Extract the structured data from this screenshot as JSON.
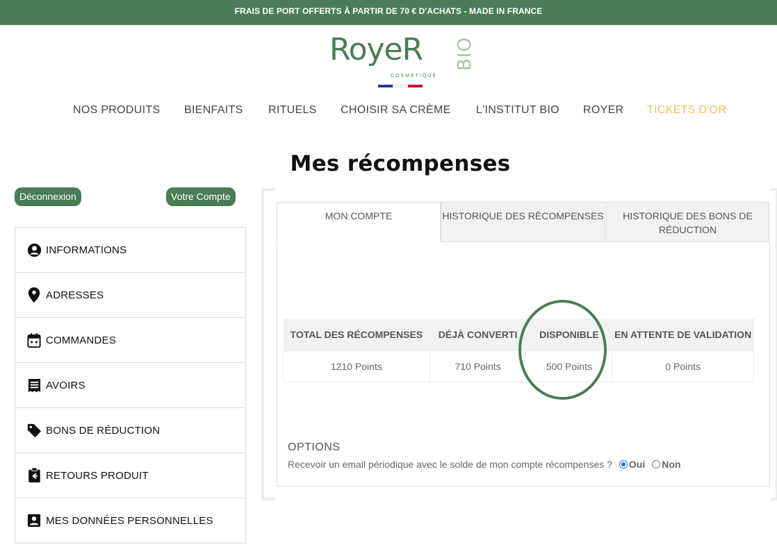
{
  "topbar": {
    "text": "FRAIS DE PORT OFFERTS À PARTIR DE 70 € D'ACHATS - MADE IN FRANCE"
  },
  "logo": {
    "word": "RoyeR",
    "bio": "BIO",
    "sub": "COSMETIQUE"
  },
  "colors": {
    "brand_green": "#4a7d56",
    "gold": "#e8c15a",
    "flag_blue": "#1d3d8f",
    "flag_red": "#c8102e"
  },
  "nav": {
    "items": [
      {
        "label": "NOS PRODUITS"
      },
      {
        "label": "BIENFAITS"
      },
      {
        "label": "RITUELS"
      },
      {
        "label": "CHOISIR SA CRÈME"
      },
      {
        "label": "L'INSTITUT BIO"
      },
      {
        "label": "ROYER"
      },
      {
        "label": "TICKETS D'OR"
      }
    ]
  },
  "page": {
    "title": "Mes récompenses"
  },
  "account": {
    "logout_label": "Déconnexion",
    "account_label": "Votre Compte"
  },
  "sidebar": {
    "items": [
      {
        "label": "INFORMATIONS",
        "icon": "user-circle-icon"
      },
      {
        "label": "ADRESSES",
        "icon": "map-pin-icon"
      },
      {
        "label": "COMMANDES",
        "icon": "calendar-icon"
      },
      {
        "label": "AVOIRS",
        "icon": "receipt-icon"
      },
      {
        "label": "BONS DE RÉDUCTION",
        "icon": "tag-icon"
      },
      {
        "label": "RETOURS PRODUIT",
        "icon": "return-clipboard-icon"
      },
      {
        "label": "MES DONNÉES PERSONNELLES",
        "icon": "id-card-icon"
      }
    ]
  },
  "tabs": [
    {
      "label": "MON COMPTE"
    },
    {
      "label": "HISTORIQUE DES RÉCOMPENSES"
    },
    {
      "label": "HISTORIQUE DES BONS DE RÉDUCTION"
    }
  ],
  "rewards_table": {
    "headers": [
      "TOTAL DES RÉCOMPENSES",
      "DÉJÀ CONVERTI",
      "DISPONIBLE",
      "EN ATTENTE DE VALIDATION"
    ],
    "values": [
      "1210 Points",
      "710 Points",
      "500 Points",
      "0 Points"
    ]
  },
  "options": {
    "title": "OPTIONS",
    "question": "Recevoir un email périodique avec le solde de mon compte récompenses ?",
    "yes_label": "Oui",
    "no_label": "Non",
    "selected": "Oui"
  }
}
